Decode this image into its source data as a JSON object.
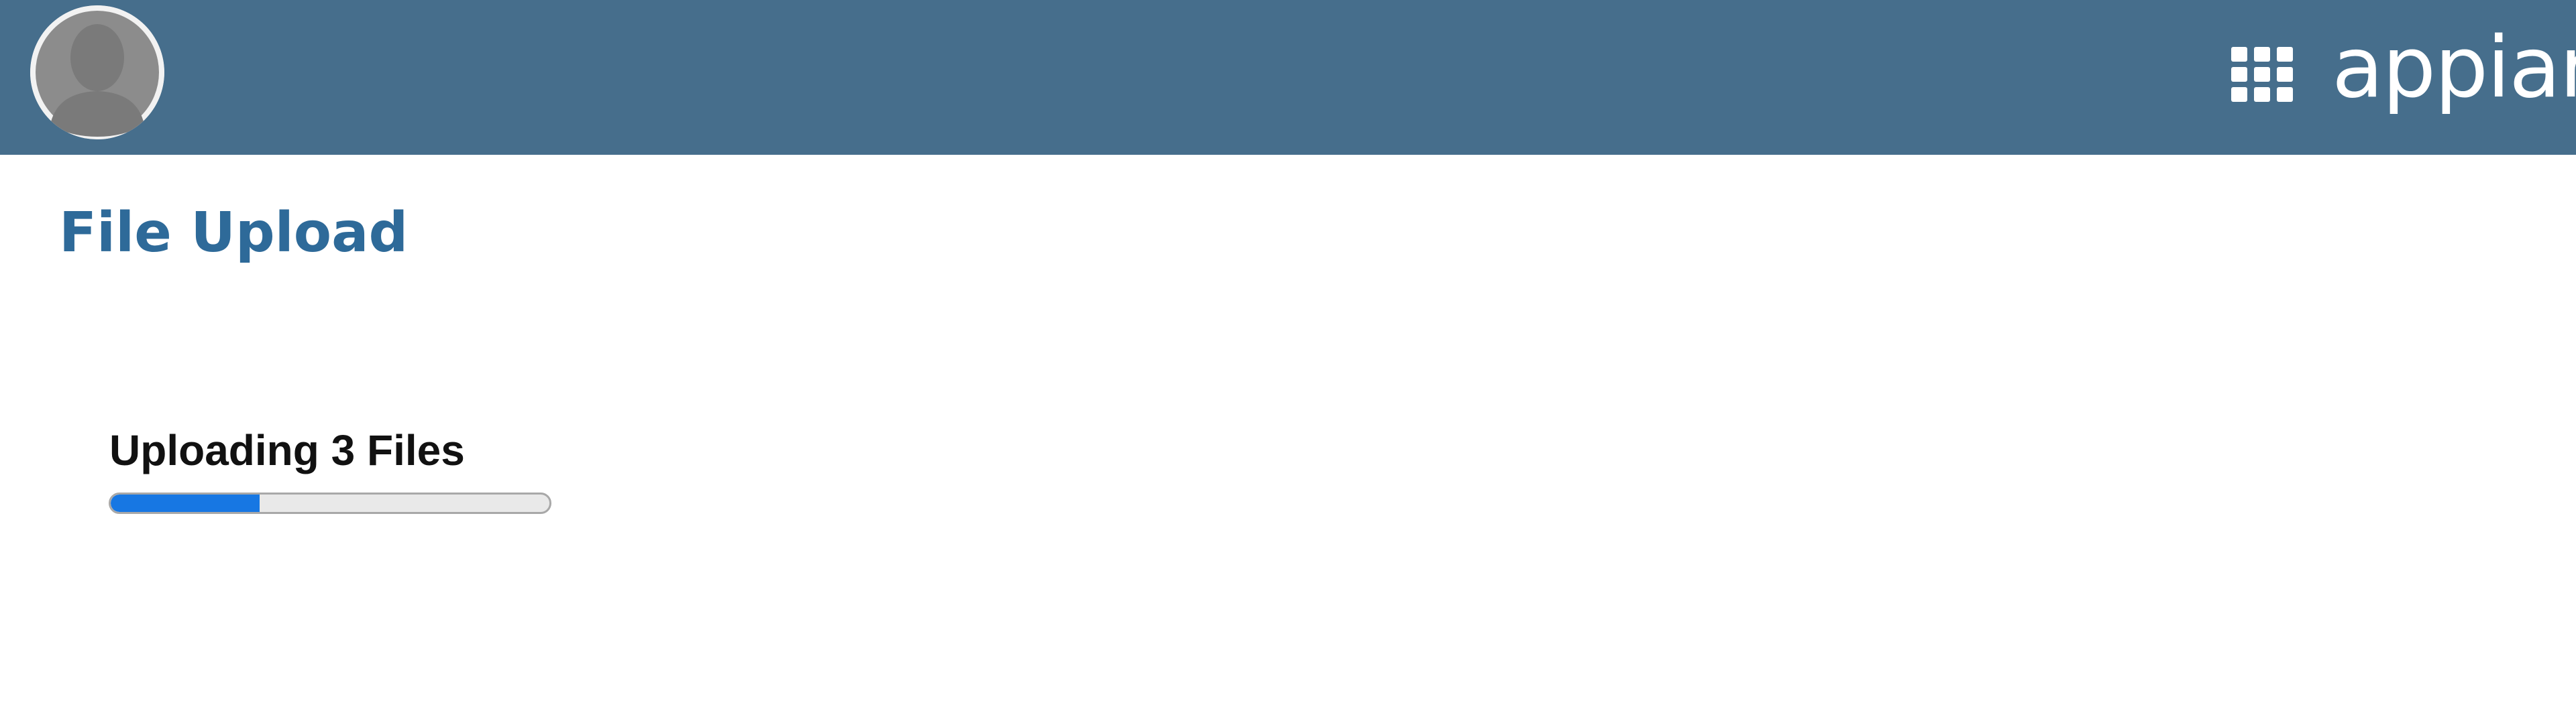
{
  "header": {
    "background_color": "#466e8c",
    "avatar_icon": "user-avatar-placeholder",
    "apps_icon": "grid-apps-icon",
    "logo_text": "appian"
  },
  "main": {
    "title": "File Upload",
    "title_color": "#2e6a99",
    "upload": {
      "label": "Uploading 3 Files",
      "progress_percent": 34,
      "progress_color": "#1777e3"
    }
  }
}
